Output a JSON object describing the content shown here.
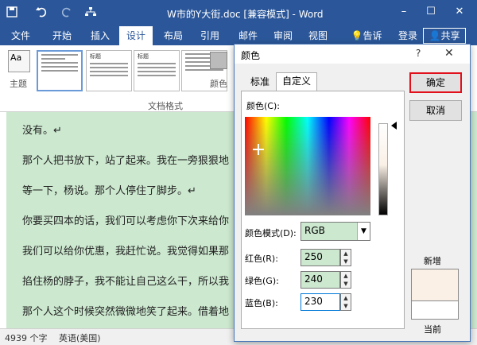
{
  "window": {
    "title": "W市的Y大街.doc [兼容模式] - Word",
    "minimize": "–",
    "maximize": "☐",
    "close": "✕"
  },
  "qa_icons": [
    "save-icon",
    "undo-icon",
    "redo-icon",
    "tree-icon"
  ],
  "ribbon_tabs": [
    "文件",
    "开始",
    "插入",
    "设计",
    "布局",
    "引用",
    "邮件",
    "审阅",
    "视图",
    "告诉我...",
    "登录"
  ],
  "ribbon_tab_active": "设计",
  "share_label": "共享",
  "ribbon": {
    "theme_label": "主题",
    "color_label": "颜色",
    "group_label": "文档格式",
    "aa": "Aa",
    "thumb_title": "标题"
  },
  "document": {
    "paragraphs": [
      "没有。↵",
      "那个人把书放下，站了起来。我在一旁狠狠地",
      "等一下，杨说。那个人停住了脚步。↵",
      "你要买四本的话，我们可以考虑你下次来给你",
      "我们可以给你优惠，我赶忙说。我觉得如果那",
      "掐住杨的脖子，我不能让自己这么干，所以我",
      "那个人这个时候突然微微地笑了起来。借着地"
    ]
  },
  "status": {
    "word_count": "4939 个字",
    "language": "英语(美国)"
  },
  "dialog": {
    "title": "颜色",
    "help": "?",
    "close": "✕",
    "tabs": [
      "标准",
      "自定义"
    ],
    "active_tab": "自定义",
    "color_label": "颜色(C):",
    "model_label": "颜色模式(D):",
    "model_value": "RGB",
    "red_label": "红色(R):",
    "green_label": "绿色(G):",
    "blue_label": "蓝色(B):",
    "red": "250",
    "green": "240",
    "blue": "230",
    "ok": "确定",
    "cancel": "取消",
    "new_label": "新增",
    "current_label": "当前",
    "new_color": "#faf0e6",
    "current_color": "#ffffff"
  }
}
